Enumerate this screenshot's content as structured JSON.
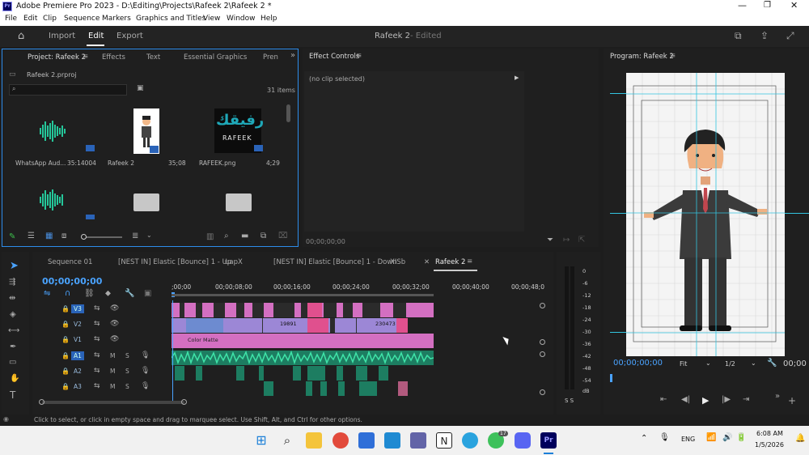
{
  "window": {
    "title": "Adobe Premiere Pro 2023 - D:\\Editing\\Projects\\Rafeek 2\\Rafeek 2 *"
  },
  "menu": [
    "File",
    "Edit",
    "Clip",
    "Sequence",
    "Markers",
    "Graphics and Titles",
    "View",
    "Window",
    "Help"
  ],
  "workspace": {
    "import": "Import",
    "edit": "Edit",
    "export": "Export",
    "project_title": "Rafeek 2",
    "edited": "- Edited"
  },
  "project_panel": {
    "tabs": [
      "Project: Rafeek 2",
      "Effects",
      "Text",
      "Essential Graphics",
      "Pren"
    ],
    "file": "Rafeek 2.prproj",
    "search_placeholder": "",
    "item_count": "31 items",
    "items": [
      {
        "name": "WhatsApp Aud...",
        "duration": "35:14004"
      },
      {
        "name": "Rafeek 2",
        "duration": "35;08"
      },
      {
        "name": "RAFEEK.png",
        "duration": "4;29"
      }
    ],
    "logo_arabic": "رفيقك",
    "logo_latin": "RAFEEK"
  },
  "effect_controls": {
    "tab": "Effect Controls",
    "no_clip": "(no clip selected)",
    "timecode": "00;00;00;00"
  },
  "program": {
    "tab": "Program: Rafeek 2",
    "timecode": "00;00;00;00",
    "fit": "Fit",
    "quality": "1/2",
    "end_tc": "00;00"
  },
  "timeline": {
    "tabs": [
      "Sequence 01",
      "[NEST IN] Elastic [Bounce] 1 - Up",
      "uapX",
      "[NEST IN] Elastic [Bounce] 1 - Down",
      "XISb",
      "Rafeek 2"
    ],
    "timecode": "00;00;00;00",
    "ruler": [
      ";00;00",
      "00;00;08;00",
      "00;00;16;00",
      "00;00;24;00",
      "00;00;32;00",
      "00;00;40;00",
      "00;00;48;0"
    ],
    "video_tracks": [
      "V3",
      "V2",
      "V1"
    ],
    "audio_tracks": [
      "A1",
      "A2",
      "A3"
    ],
    "clip_labels": {
      "color_matte": "Color Matte",
      "n1": "19891",
      "n2": "230473"
    },
    "meter": [
      "0",
      "-6",
      "-12",
      "-18",
      "-24",
      "-30",
      "-36",
      "-42",
      "-48",
      "-54",
      "dB"
    ],
    "solo": "S S"
  },
  "status": "Click to select, or click in empty space and drag to marquee select. Use Shift, Alt, and Ctrl for other options.",
  "taskbar": {
    "lang": "ENG",
    "time": "6:08 AM",
    "date": "1/5/2026",
    "badge": "17"
  }
}
